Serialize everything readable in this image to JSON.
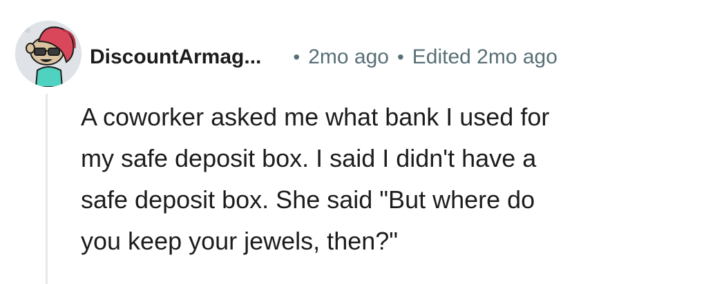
{
  "comment": {
    "author": "DiscountArmag...",
    "separator": "•",
    "time": "2mo ago",
    "edited": "Edited 2mo ago",
    "body": "A coworker asked me what bank I used for\nmy safe deposit box. I said I didn't have a\nsafe deposit box. She said \"But where do\nyou keep your jewels, then?\""
  },
  "avatar": {
    "icon": "snoo-avatar-icon",
    "hair_color": "#d9475a",
    "shirt_color": "#4fd2c0"
  }
}
